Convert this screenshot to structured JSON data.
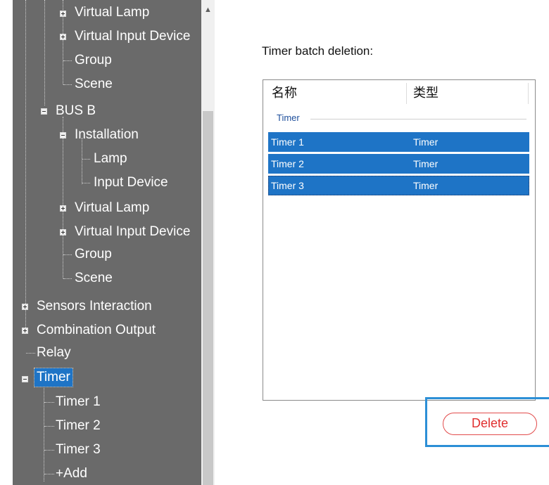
{
  "tree": {
    "items": [
      {
        "label": "Virtual Lamp"
      },
      {
        "label": "Virtual Input Device"
      },
      {
        "label": "Group"
      },
      {
        "label": "Scene"
      },
      {
        "label": "BUS B"
      },
      {
        "label": "Installation"
      },
      {
        "label": "Lamp"
      },
      {
        "label": "Input Device"
      },
      {
        "label": "Virtual Lamp"
      },
      {
        "label": "Virtual Input Device"
      },
      {
        "label": "Group"
      },
      {
        "label": "Scene"
      },
      {
        "label": "Sensors Interaction"
      },
      {
        "label": "Combination Output"
      },
      {
        "label": "Relay"
      },
      {
        "label": "Timer"
      },
      {
        "label": "Timer 1"
      },
      {
        "label": "Timer 2"
      },
      {
        "label": "Timer 3"
      },
      {
        "label": "+Add"
      }
    ],
    "scroll_up_glyph": "▲"
  },
  "panel": {
    "title": "Timer batch deletion:",
    "columns": [
      "名称",
      "类型"
    ],
    "group_label": "Timer",
    "rows": [
      {
        "name": "Timer 1",
        "type": "Timer"
      },
      {
        "name": "Timer 2",
        "type": "Timer"
      },
      {
        "name": "Timer 3",
        "type": "Timer"
      }
    ],
    "delete_label": "Delete"
  },
  "colors": {
    "tree_background": "#6a6a6a",
    "selection": "#1e74c6",
    "delete_text": "#e02f2f",
    "highlight_frame": "#2c8fd6"
  }
}
